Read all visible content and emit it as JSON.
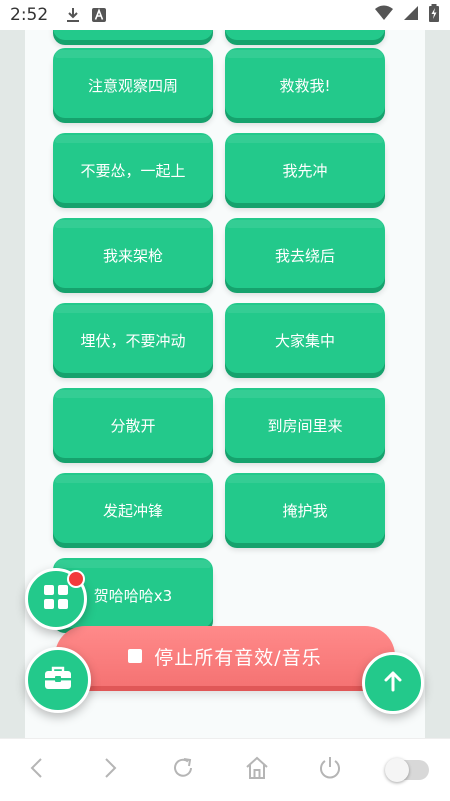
{
  "status_bar": {
    "time": "2:52",
    "icons": [
      "download-icon",
      "text-a-icon",
      "wifi-icon",
      "signal-icon",
      "battery-charging-icon"
    ]
  },
  "sound_buttons": [
    "注意观察四周",
    "救救我!",
    "不要怂，一起上",
    "我先冲",
    "我来架枪",
    "我去绕后",
    "埋伏，不要冲动",
    "大家集中",
    "分散开",
    "到房间里来",
    "发起冲锋",
    "掩护我",
    "贺哈哈哈x3"
  ],
  "stop_button": {
    "label": "停止所有音效/音乐"
  },
  "fabs": {
    "grid": "grid-icon",
    "toolbox": "toolbox-icon",
    "scroll_top": "arrow-up-icon"
  },
  "colors": {
    "button_green": "#23c98b",
    "button_green_shadow": "#16a26d",
    "stop_red": "#f57373",
    "badge_red": "#f23b3b",
    "page_bg": "#e2e8e6"
  },
  "nav_bar": {
    "icons": [
      "back-icon",
      "forward-icon",
      "reload-icon",
      "home-icon",
      "power-icon",
      "toggle-switch"
    ]
  }
}
